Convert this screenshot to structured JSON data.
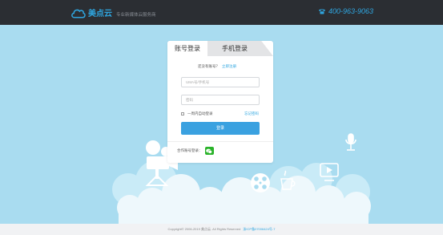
{
  "header": {
    "logo_name": "美点云",
    "slogan": "专业新媒体云服务商",
    "phone": "400-963-9063"
  },
  "login": {
    "tab_account": "账号登录",
    "tab_phone": "手机登录",
    "no_account_text": "还没有账号？",
    "register_link": "立即注册",
    "username_placeholder": "UMA号/手机号",
    "password_placeholder": "密码",
    "remember_label": "一周内自动登录",
    "forgot_link": "忘记密码",
    "login_button": "登录",
    "partner_login_label": "合作账号登录："
  },
  "footer": {
    "copyright": "Copyright© 2006-2019 美点云. All Rights Reserved",
    "icp": "浙ICP备07006424号-7"
  },
  "colors": {
    "accent": "#3aa1e0",
    "header_bg": "#2b2e33",
    "sky": "#a9dcf0",
    "wechat": "#2ab32a"
  },
  "icons": {
    "logo": "cloud-logo-icon",
    "phone": "telephone-icon",
    "wechat": "wechat-icon"
  }
}
